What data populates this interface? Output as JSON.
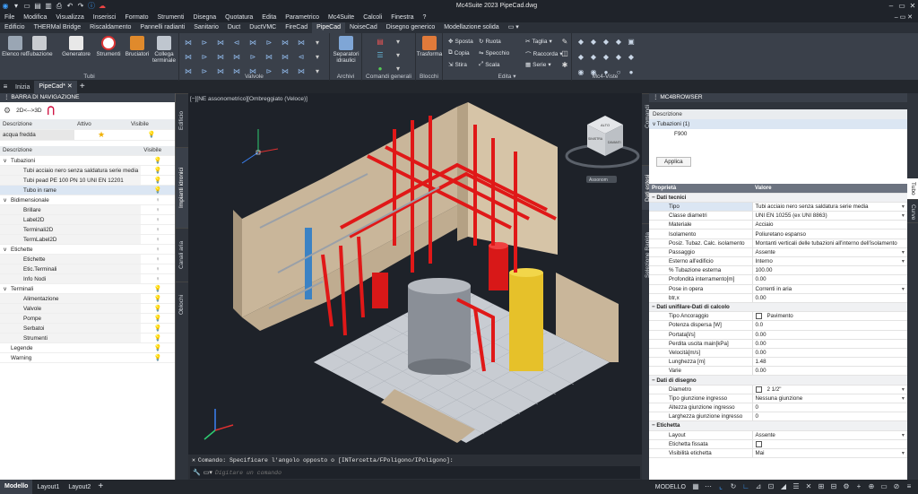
{
  "titlebar": {
    "title": "Mc4Suite 2023    PipeCad.dwg"
  },
  "menu": [
    "File",
    "Modifica",
    "Visualizza",
    "Inserisci",
    "Formato",
    "Strumenti",
    "Disegna",
    "Quotatura",
    "Edita",
    "Parametrico",
    "Mc4Suite",
    "Calcoli",
    "Finestra",
    "?"
  ],
  "ribbon_tabs": [
    "Edificio",
    "THERMal Bridge",
    "Riscaldamento",
    "Pannelli radianti",
    "Sanitario",
    "Duct",
    "DuctVMC",
    "FireCad",
    "PipeCad",
    "NoiseCad",
    "Disegno generico",
    "Modellazione solida"
  ],
  "ribbon_active": "PipeCad",
  "ribbon": {
    "tubi": {
      "title": "Tubi",
      "elenco": "Elenco reti",
      "tubazione": "Tubazione",
      "generatore": "Generatore",
      "strumenti": "Strumenti",
      "bruciatori": "Bruciatori",
      "collega": "Collega terminale"
    },
    "valvole": {
      "title": "Valvole"
    },
    "archivi": {
      "title": "Archivi",
      "separatori": "Separatori idraulici"
    },
    "comandi": {
      "title": "Comandi generali"
    },
    "blocchi": {
      "title": "Blocchi",
      "trasforma": "Trasforma"
    },
    "edita": {
      "title": "Edita",
      "sposta": "Sposta",
      "ruota": "Ruota",
      "taglia": "Taglia",
      "copia": "Copia",
      "specchio": "Specchio",
      "raccorda": "Raccorda",
      "stira": "Stira",
      "scala": "Scala",
      "serie": "Serie"
    },
    "viste": {
      "title": "Mc4-Viste"
    }
  },
  "doctabs": [
    "Inizia",
    "PipeCad*"
  ],
  "nav": {
    "title": "BARRA DI NAVIGAZIONE",
    "toggle": "2D<-->3D",
    "top_headers": [
      "Descrizione",
      "Attivo",
      "Visibile"
    ],
    "top_row": "acqua fredda",
    "headers": [
      "Descrizione",
      "Visibile"
    ],
    "tree": [
      {
        "label": "Tubazioni",
        "level": 0,
        "exp": "v",
        "vis": "on"
      },
      {
        "label": "Tubi acciaio nero senza saldatura serie media",
        "level": 1,
        "exp": "",
        "vis": "on"
      },
      {
        "label": "Tubi pead PE 100 PN 10 UNI EN 12201",
        "level": 1,
        "exp": "",
        "vis": "on"
      },
      {
        "label": "Tubo in rame",
        "level": 1,
        "exp": "",
        "vis": "on",
        "sel": true
      },
      {
        "label": "Bidimensionale",
        "level": 0,
        "exp": "v",
        "vis": "off"
      },
      {
        "label": "Brillare",
        "level": 1,
        "exp": "",
        "vis": "off"
      },
      {
        "label": "Label2D",
        "level": 1,
        "exp": "",
        "vis": "off"
      },
      {
        "label": "Terminali2D",
        "level": 1,
        "exp": "",
        "vis": "off"
      },
      {
        "label": "TermLabel2D",
        "level": 1,
        "exp": "",
        "vis": "off"
      },
      {
        "label": "Etichette",
        "level": 0,
        "exp": "v",
        "vis": "off"
      },
      {
        "label": "Etichette",
        "level": 1,
        "exp": "",
        "vis": "off"
      },
      {
        "label": "Etic.Terminali",
        "level": 1,
        "exp": "",
        "vis": "off"
      },
      {
        "label": "Info Nodi",
        "level": 1,
        "exp": "",
        "vis": "off"
      },
      {
        "label": "Terminali",
        "level": 0,
        "exp": "v",
        "vis": "on"
      },
      {
        "label": "Alimentazione",
        "level": 1,
        "exp": "",
        "vis": "on"
      },
      {
        "label": "Valvole",
        "level": 1,
        "exp": "",
        "vis": "on"
      },
      {
        "label": "Pompe",
        "level": 1,
        "exp": "",
        "vis": "on"
      },
      {
        "label": "Serbatoi",
        "level": 1,
        "exp": "",
        "vis": "on"
      },
      {
        "label": "Strumenti",
        "level": 1,
        "exp": "",
        "vis": "on"
      },
      {
        "label": "Legende",
        "level": 0,
        "exp": "",
        "vis": "on"
      },
      {
        "label": "Warning",
        "level": 0,
        "exp": "",
        "vis": "on"
      }
    ]
  },
  "left_side_tabs": [
    "Edificio",
    "Impianti idronici",
    "Canali aria",
    "Oblochi"
  ],
  "viewport": {
    "label": "[−][NE assonometrico][Ombreggiato (Veloce)]",
    "cube_top": "ALTO",
    "cube_left": "SINISTRA",
    "cube_front": "DAVANTI",
    "cube_btn": "Assonom"
  },
  "command": {
    "history": "Comando: Specificare l'angolo opposto o [INTercetta/FPoligono/IPoligono]:",
    "placeholder": "Digitare un comando"
  },
  "right_side_tabs": [
    "Comandi",
    "Dati estesi",
    "Selezione Rapida"
  ],
  "right_edge_tabs": [
    "Tubo",
    "Curve"
  ],
  "browser": {
    "title": "MC4BROWSER",
    "desc_header": "Descrizione",
    "tree_root": "Tubazioni (1)",
    "tree_child": "F900",
    "apply": "Applica",
    "headers": [
      "Proprietà",
      "Valore"
    ],
    "sections": [
      {
        "title": "Dati tecnici",
        "rows": [
          [
            "Tipo",
            "Tubi acciaio nero senza saldatura serie media",
            "dd"
          ],
          [
            "Classe diametri",
            "UNI EN 10255 (ex UNI 8863)",
            "dd"
          ],
          [
            "Materiale",
            "Acciaio",
            ""
          ],
          [
            "Isolamento",
            "Poliuretano espanso",
            ""
          ],
          [
            "Posiz. Tubaz. Calc. isolamento",
            "Montanti verticali delle tubazioni all'interno dell'isolamento",
            ""
          ],
          [
            "Passaggio",
            "Assente",
            "dd"
          ],
          [
            "Esterno all'edificio",
            "Interno",
            "dd"
          ],
          [
            "% Tubazione esterna",
            "100.00",
            ""
          ],
          [
            "Profondità interramento[m]",
            "0.00",
            ""
          ],
          [
            "Pose in opera",
            "Correnti in aria",
            "dd"
          ],
          [
            "btr,x",
            "0.00",
            ""
          ]
        ]
      },
      {
        "title": "Dati unifilare-Dati di calcolo",
        "rows": [
          [
            "Tipo Ancoraggio",
            "Pavimento",
            "cb"
          ],
          [
            "Potenza dispersa [W]",
            "0.0",
            ""
          ],
          [
            "Portata[l/s]",
            "0.00",
            ""
          ],
          [
            "Perdita uscita main[kPa]",
            "0.00",
            ""
          ],
          [
            "Velocità[m/s]",
            "0.00",
            ""
          ],
          [
            "Lunghezza [m]",
            "1.48",
            ""
          ],
          [
            "Varie",
            "0.00",
            ""
          ]
        ]
      },
      {
        "title": "Dati di disegno",
        "rows": [
          [
            "Diametro",
            "2 1/2\"",
            "cbdd"
          ],
          [
            "Tipo giunzione ingresso",
            "Nessuna giunzione",
            "dd"
          ],
          [
            "Altezza giunzione ingresso",
            "0",
            ""
          ],
          [
            "Larghezza giunzione ingresso",
            "0",
            ""
          ]
        ]
      },
      {
        "title": "Etichetta",
        "rows": [
          [
            "Layout",
            "Assente",
            "dd"
          ],
          [
            "Etichetta fissata",
            "",
            "cb"
          ],
          [
            "Visibilità etichetta",
            "Mai",
            "dd"
          ]
        ]
      }
    ]
  },
  "layouts": [
    "Modello",
    "Layout1",
    "Layout2"
  ],
  "status": {
    "mode": "MODELLO"
  },
  "colors": {
    "accent": "#3b82c4",
    "pipe_red": "#e01818",
    "wall": "#c9b69a",
    "floor": "#c8ccd2",
    "dark": "#1e2229"
  }
}
